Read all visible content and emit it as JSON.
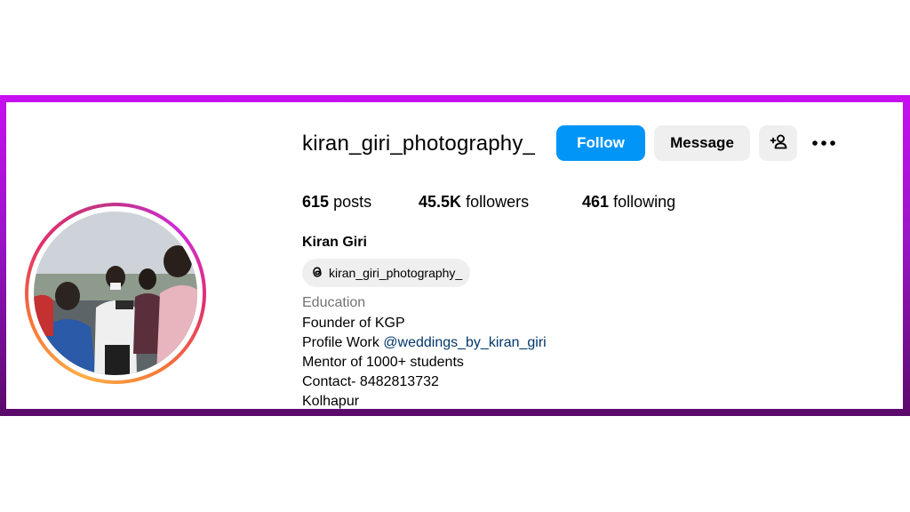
{
  "profile": {
    "username": "kiran_giri_photography_",
    "full_name": "Kiran Giri",
    "threads_handle": "kiran_giri_photography_",
    "category": "Education"
  },
  "actions": {
    "follow_label": "Follow",
    "message_label": "Message"
  },
  "stats": {
    "posts_count": "615",
    "posts_label": "posts",
    "followers_count": "45.5K",
    "followers_label": "followers",
    "following_count": "461",
    "following_label": "following"
  },
  "bio": {
    "line1": "Founder of KGP",
    "line2_prefix": "Profile Work ",
    "line2_mention": "@weddings_by_kiran_giri",
    "line3": "Mentor of 1000+ students",
    "line4": "Contact- 8482813732",
    "line5": "Kolhapur"
  },
  "icons": {
    "add_user": "add-user-icon",
    "more": "more-options-icon",
    "threads": "threads-icon"
  },
  "colors": {
    "follow_button": "#0095f6",
    "secondary_button": "#efefef",
    "mention": "#00376b",
    "frame_top": "#c80ff0",
    "frame_bottom": "#5a0a6a"
  }
}
